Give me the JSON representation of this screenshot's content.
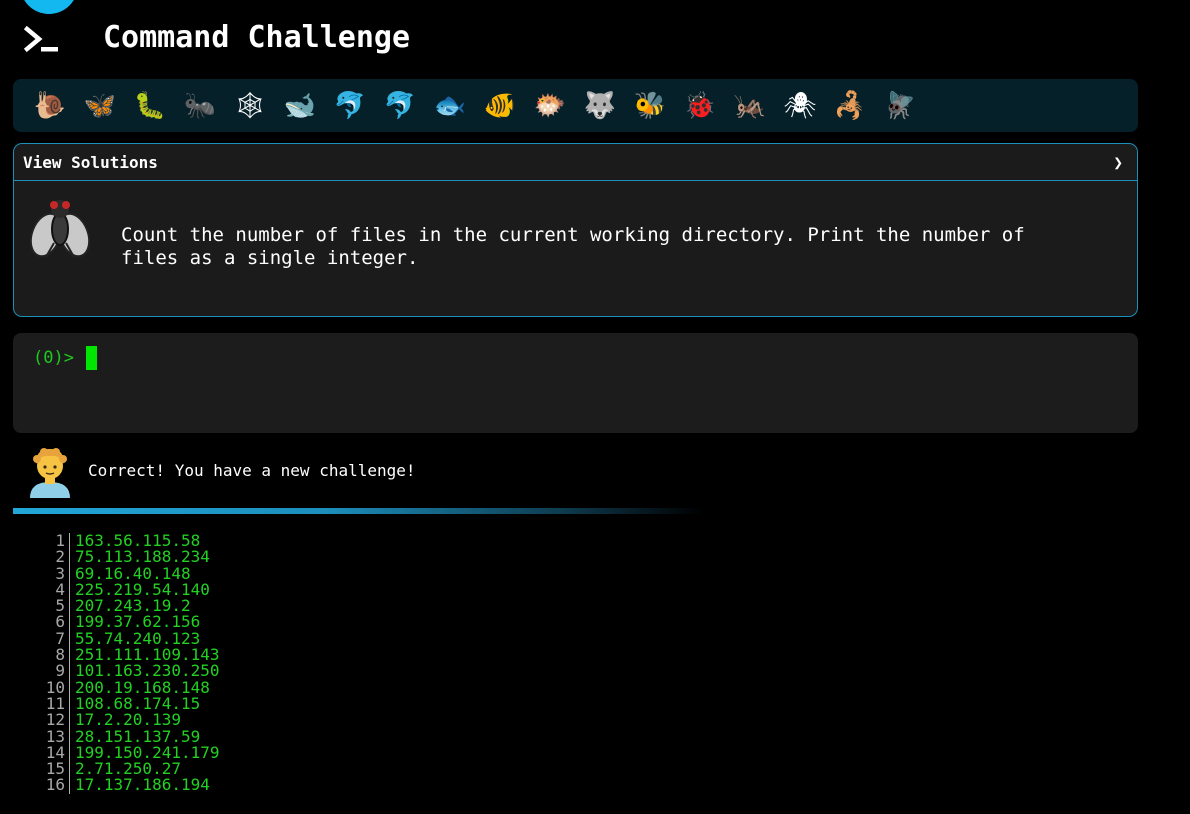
{
  "header": {
    "title": "Command Challenge"
  },
  "animals": [
    {
      "name": "snail",
      "glyph": "🐌"
    },
    {
      "name": "butterfly",
      "glyph": "🦋"
    },
    {
      "name": "caterpillar",
      "glyph": "🐛"
    },
    {
      "name": "ant",
      "glyph": "🐜"
    },
    {
      "name": "spider-web",
      "glyph": "🕸"
    },
    {
      "name": "whale",
      "glyph": "🐋"
    },
    {
      "name": "dolphin-jumping",
      "glyph": "🐬"
    },
    {
      "name": "dolphin",
      "glyph": "🐬"
    },
    {
      "name": "fish",
      "glyph": "🐟"
    },
    {
      "name": "tropical-fish",
      "glyph": "🐠"
    },
    {
      "name": "blowfish",
      "glyph": "🐡"
    },
    {
      "name": "wolf",
      "glyph": "🐺"
    },
    {
      "name": "bee",
      "glyph": "🐝"
    },
    {
      "name": "ladybug",
      "glyph": "🐞"
    },
    {
      "name": "cricket",
      "glyph": "🦗"
    },
    {
      "name": "spider",
      "glyph": "🕷"
    },
    {
      "name": "scorpion",
      "glyph": "🦂"
    },
    {
      "name": "fly",
      "glyph": "🪰"
    }
  ],
  "challenge": {
    "solutions_label": "View Solutions",
    "chevron": "❯",
    "text": "Count the number of files in the current working directory. Print the number of files as a single integer."
  },
  "terminal": {
    "prompt": "(0)>"
  },
  "status": {
    "message": "Correct! You have a new challenge!"
  },
  "output": [
    {
      "n": "1",
      "v": "163.56.115.58"
    },
    {
      "n": "2",
      "v": "75.113.188.234"
    },
    {
      "n": "3",
      "v": "69.16.40.148"
    },
    {
      "n": "4",
      "v": "225.219.54.140"
    },
    {
      "n": "5",
      "v": "207.243.19.2"
    },
    {
      "n": "6",
      "v": "199.37.62.156"
    },
    {
      "n": "7",
      "v": "55.74.240.123"
    },
    {
      "n": "8",
      "v": "251.111.109.143"
    },
    {
      "n": "9",
      "v": "101.163.230.250"
    },
    {
      "n": "10",
      "v": "200.19.168.148"
    },
    {
      "n": "11",
      "v": "108.68.174.15"
    },
    {
      "n": "12",
      "v": "17.2.20.139"
    },
    {
      "n": "13",
      "v": "28.151.137.59"
    },
    {
      "n": "14",
      "v": "199.150.241.179"
    },
    {
      "n": "15",
      "v": "2.71.250.27"
    },
    {
      "n": "16",
      "v": "17.137.186.194"
    }
  ],
  "colors": {
    "accent": "#14b8f0",
    "border": "#1a8fb8",
    "prompt": "#1ec81e",
    "cursor": "#00e600",
    "output_text": "#22d122"
  }
}
